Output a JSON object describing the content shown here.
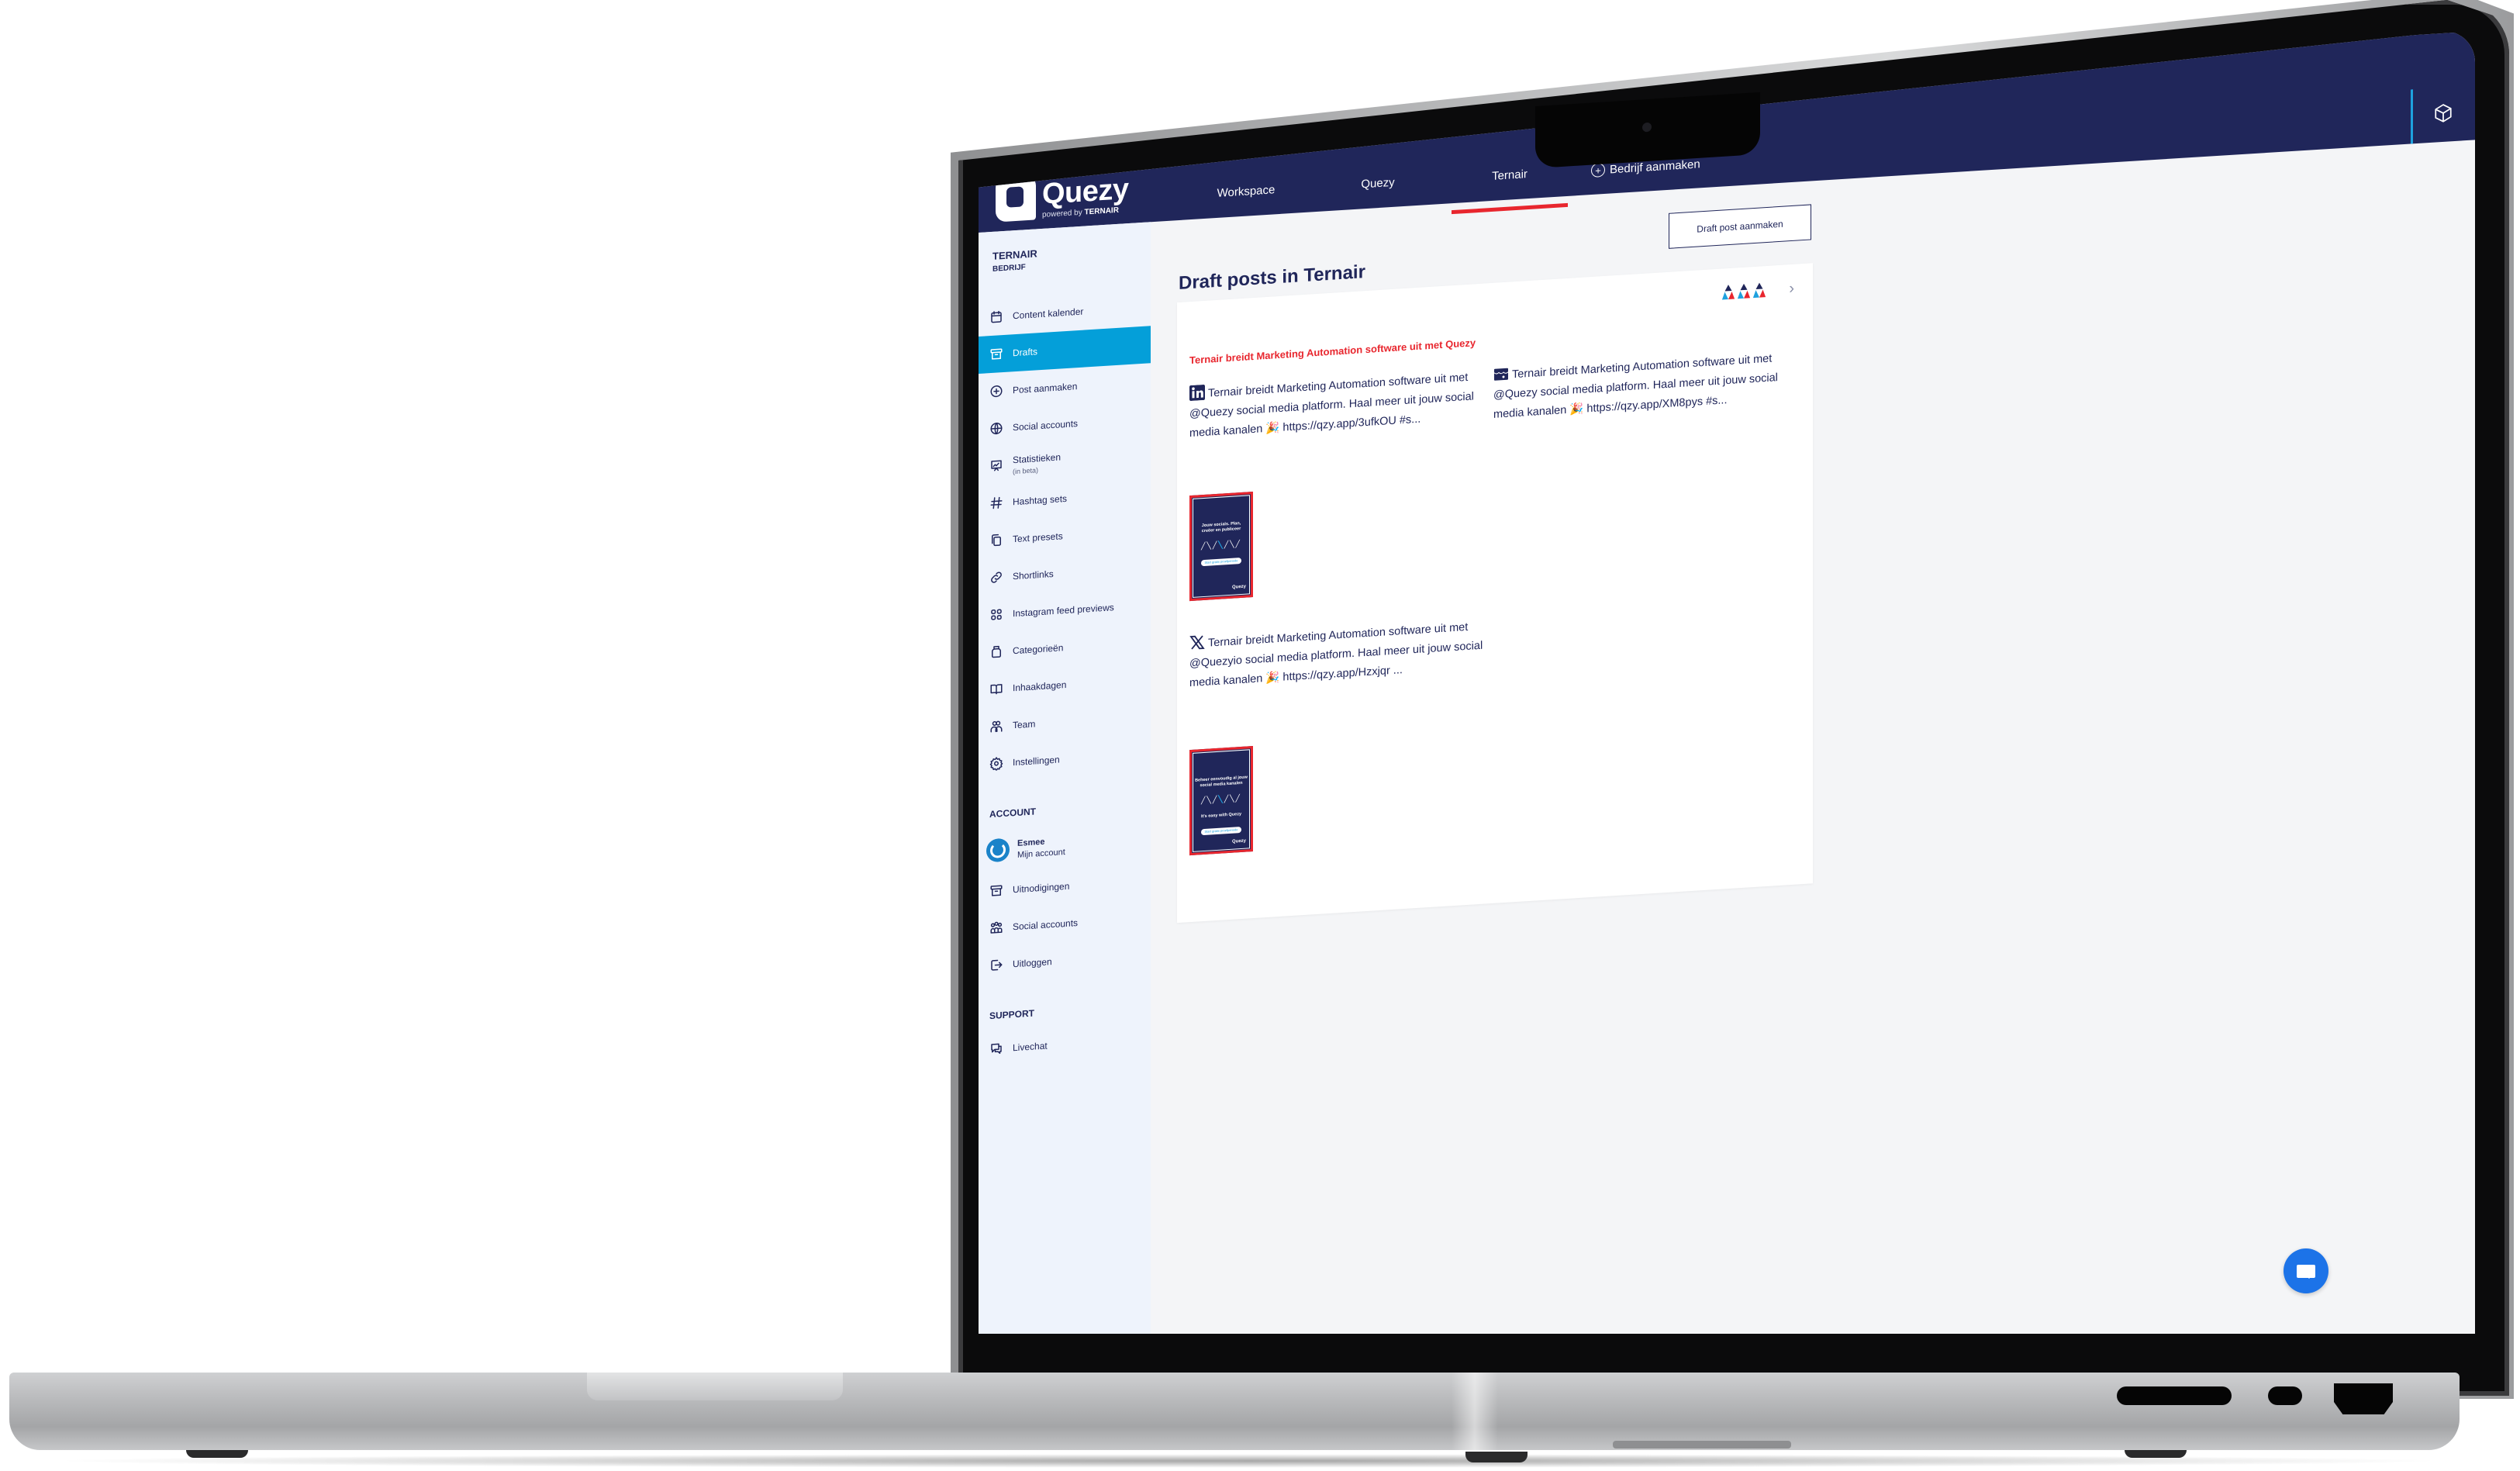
{
  "app": {
    "logo_name": "Quezy",
    "logo_sub_prefix": "powered by",
    "logo_sub_brand": "TERNAIR"
  },
  "topnav": {
    "items": [
      {
        "label": "Workspace",
        "active": false
      },
      {
        "label": "Quezy",
        "active": false
      },
      {
        "label": "Ternair",
        "active": true
      }
    ],
    "add_company_label": "Bedrijf aanmaken",
    "right_icon": "cube-icon"
  },
  "sidebar": {
    "org_name": "TERNAIR",
    "org_type": "BEDRIJF",
    "items": [
      {
        "label": "Content kalender",
        "icon": "calendar-icon"
      },
      {
        "label": "Drafts",
        "icon": "archive-icon",
        "active": true
      },
      {
        "label": "Post aanmaken",
        "icon": "plus-circle-icon"
      },
      {
        "label": "Social accounts",
        "icon": "globe-icon"
      },
      {
        "label": "Statistieken",
        "sublabel": "(in beta)",
        "icon": "presentation-chart-icon"
      },
      {
        "label": "Hashtag sets",
        "icon": "hashtag-icon"
      },
      {
        "label": "Text presets",
        "icon": "copy-icon"
      },
      {
        "label": "Shortlinks",
        "icon": "link-icon"
      },
      {
        "label": "Instagram feed previews",
        "icon": "grid-icon"
      },
      {
        "label": "Categorieën",
        "icon": "jar-icon"
      },
      {
        "label": "Inhaakdagen",
        "icon": "book-icon"
      },
      {
        "label": "Team",
        "icon": "users-icon"
      },
      {
        "label": "Instellingen",
        "icon": "gear-icon"
      }
    ],
    "account_heading": "ACCOUNT",
    "account": {
      "name": "Esmee",
      "link": "Mijn account"
    },
    "account_items": [
      {
        "label": "Uitnodigingen",
        "icon": "archive-icon"
      },
      {
        "label": "Social accounts",
        "icon": "user-group-icon"
      },
      {
        "label": "Uitloggen",
        "icon": "logout-icon"
      }
    ],
    "support_heading": "SUPPORT",
    "support_items": [
      {
        "label": "Livechat",
        "icon": "chat-icon"
      }
    ]
  },
  "main": {
    "title": "Draft posts in Ternair",
    "create_draft_label": "Draft post aanmaken",
    "draft_card": {
      "title": "Ternair breidt Marketing Automation software uit met Quezy",
      "posts": [
        {
          "network": "linkedin",
          "text": "Ternair breidt Marketing Automation software uit met @Quezy social media platform. Haal meer uit jouw social media kanalen 🎉 https://qzy.app/3ufkOU #s...",
          "image_text": "Jouw socials. Plan, creëer en publiceer",
          "image_button": "Start gratis proefperiode",
          "image_logo": "Quezy"
        },
        {
          "network": "facebook-store",
          "text": "Ternair breidt Marketing Automation software uit met @Quezy social media platform. Haal meer uit jouw social media kanalen 🎉 https://qzy.app/XM8pys #s..."
        },
        {
          "network": "x",
          "text": "Ternair breidt Marketing Automation software uit met @Quezyio social media platform. Haal meer uit jouw social media kanalen 🎉 https://qzy.app/Hzxjqr ...",
          "image_text": "Beheer eenvoudig al jouw social media kanalen",
          "image_sub": "It's easy with Quezy",
          "image_button": "Start gratis proefperiode",
          "image_logo": "Quezy"
        }
      ]
    }
  },
  "colors": {
    "navy": "#20265a",
    "accent_blue": "#049fd9",
    "accent_red": "#e8262e",
    "chat_blue": "#1c73e8",
    "sidebar_bg": "#eef3fc",
    "page_bg": "#f4f5f7"
  }
}
